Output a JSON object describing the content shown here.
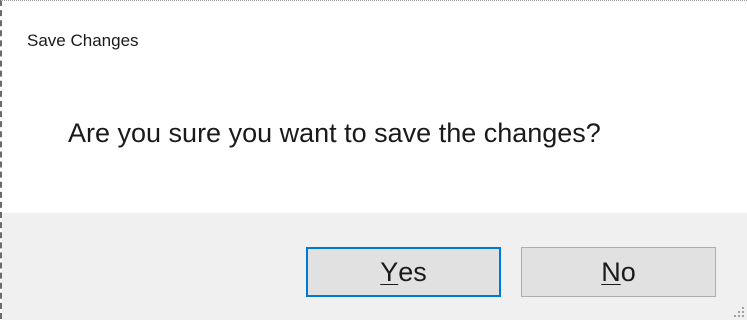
{
  "dialog": {
    "title": "Save Changes",
    "message": "Are you sure you want to save the changes?"
  },
  "buttons": {
    "yes": {
      "accelerator": "Y",
      "rest": "es",
      "default": true
    },
    "no": {
      "accelerator": "N",
      "rest": "o",
      "default": false
    }
  },
  "colors": {
    "content_background": "#ffffff",
    "button_bar_background": "#f0f0f0",
    "button_face": "#e1e1e1",
    "default_button_border": "#0078d7",
    "button_border": "#adadad",
    "text": "#1a1a1a"
  },
  "icons": {
    "resize_grip": "size-grip-icon"
  }
}
